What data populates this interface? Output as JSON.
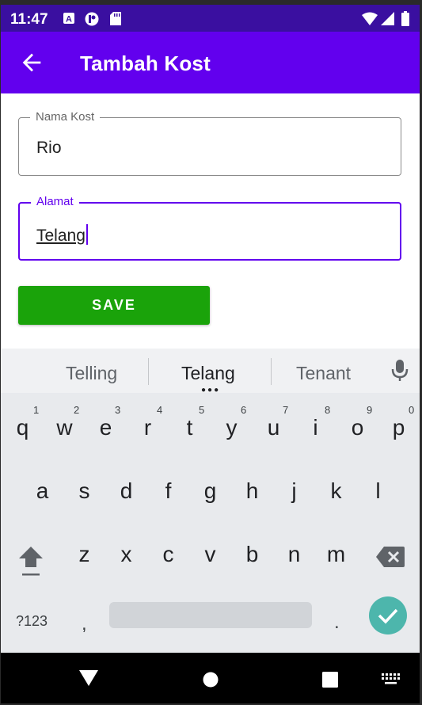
{
  "status_bar": {
    "time": "11:47"
  },
  "app_bar": {
    "title": "Tambah Kost"
  },
  "form": {
    "nama_kost": {
      "label": "Nama Kost",
      "value": "Rio"
    },
    "alamat": {
      "label": "Alamat",
      "value": "Telang"
    },
    "save_label": "SAVE"
  },
  "keyboard": {
    "suggestions": [
      "Telling",
      "Telang",
      "Tenant"
    ],
    "row1": [
      "q",
      "w",
      "e",
      "r",
      "t",
      "y",
      "u",
      "i",
      "o",
      "p"
    ],
    "row1_hints": [
      "1",
      "2",
      "3",
      "4",
      "5",
      "6",
      "7",
      "8",
      "9",
      "0"
    ],
    "row2": [
      "a",
      "s",
      "d",
      "f",
      "g",
      "h",
      "j",
      "k",
      "l"
    ],
    "row3": [
      "z",
      "x",
      "c",
      "v",
      "b",
      "n",
      "m"
    ],
    "symbols_label": "?123",
    "comma": ",",
    "period": "."
  },
  "colors": {
    "primary": "#6200ee",
    "status_bar": "#3a0fa0",
    "save_button": "#1aa30a",
    "enter_key": "#4db6ac"
  }
}
